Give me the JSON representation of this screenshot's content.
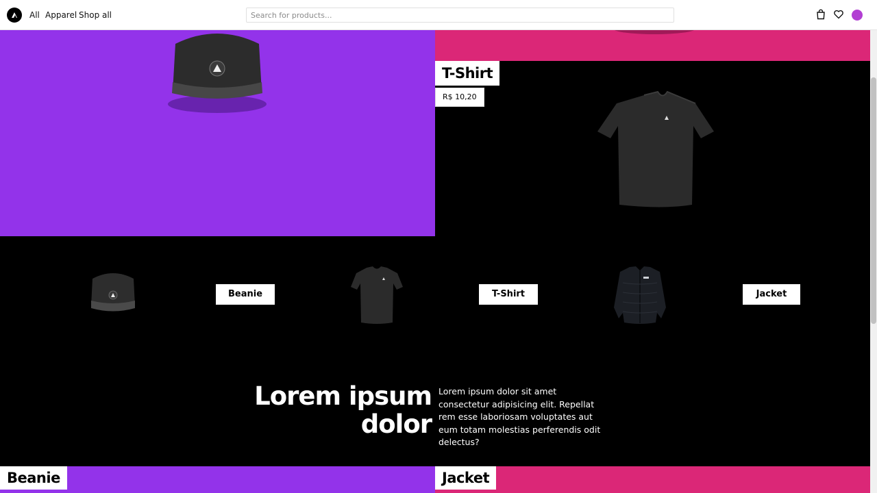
{
  "header": {
    "nav": [
      "All",
      "Apparel",
      "Shop all"
    ],
    "search_placeholder": "Search for products...",
    "icons": [
      "bag-icon",
      "heart-icon"
    ],
    "avatar_color": "#b23fd3"
  },
  "hero": {
    "left_bg": "#9333ea",
    "right_top_bg": "#db2777",
    "featured": {
      "title": "T-Shirt",
      "price": "R$ 10,20"
    }
  },
  "carousel": {
    "items": [
      {
        "label": "Beanie",
        "image": "beanie"
      },
      {
        "label": "T-Shirt",
        "image": "tshirt"
      },
      {
        "label": "Jacket",
        "image": "jacket"
      }
    ]
  },
  "promo": {
    "heading_line1": "Lorem ipsum",
    "heading_line2": "dolor",
    "body": "Lorem ipsum dolor sit amet consectetur adipisicing elit. Repellat rem esse laboriosam voluptates aut eum totam molestias perferendis odit delectus?"
  },
  "bottom": {
    "left_title": "Beanie",
    "right_title": "Jacket"
  }
}
